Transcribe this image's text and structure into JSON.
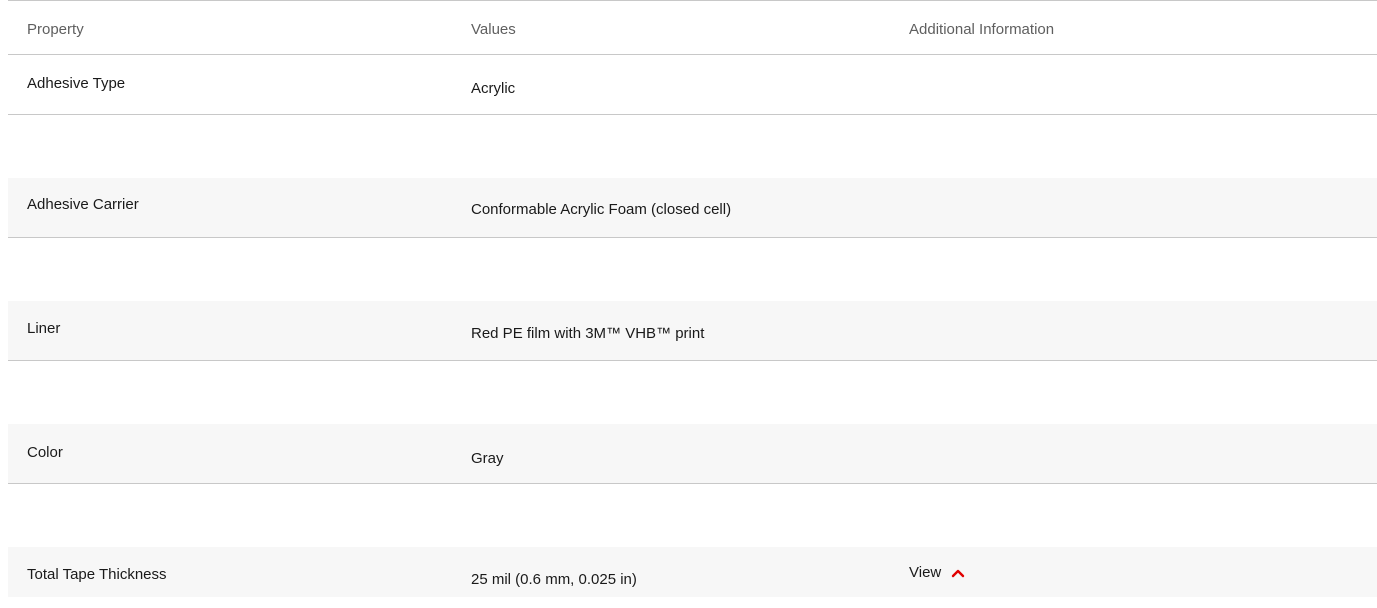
{
  "table": {
    "headers": {
      "property": "Property",
      "values": "Values",
      "additional": "Additional Information"
    },
    "rows": [
      {
        "property": "Adhesive Type",
        "value": "Acrylic",
        "additional": ""
      },
      {
        "property": "Adhesive Carrier",
        "value": "Conformable Acrylic Foam (closed cell)",
        "additional": ""
      },
      {
        "property": "Liner",
        "value": "Red PE film with 3M™ VHB™ print",
        "additional": ""
      },
      {
        "property": "Color",
        "value": "Gray",
        "additional": ""
      },
      {
        "property": "Total Tape Thickness",
        "value": "25 mil (0.6 mm, 0.025 in)",
        "additional": "View"
      }
    ],
    "view_icon": "chevron-up-icon",
    "accent_color": "#e00000"
  }
}
